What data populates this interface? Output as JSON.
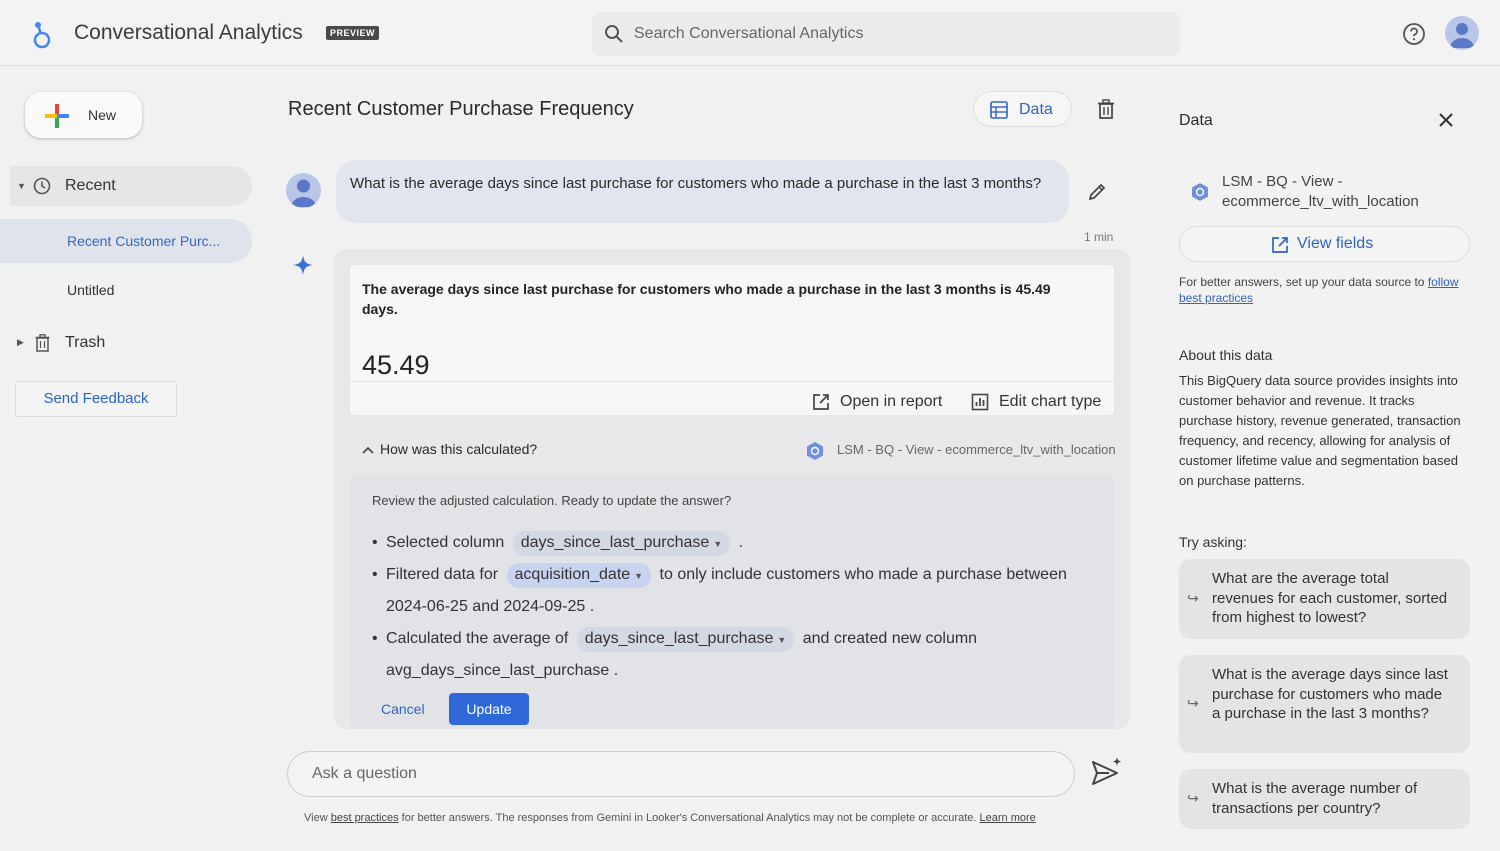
{
  "header": {
    "app_title": "Conversational Analytics",
    "badge": "PREVIEW",
    "search_placeholder": "Search Conversational Analytics",
    "icons": [
      "help-icon",
      "account-avatar"
    ]
  },
  "sidebar": {
    "new_label": "New",
    "recent_label": "Recent",
    "recent_items": [
      "Recent Customer Purc...",
      "Untitled"
    ],
    "trash_label": "Trash",
    "feedback_label": "Send Feedback"
  },
  "conversation": {
    "title": "Recent Customer Purchase Frequency",
    "data_button_label": "Data",
    "user_message": "What is the average days since last purchase for customers who made a purchase in the last 3 months?",
    "message_time": "1 min",
    "answer_text": "The average days since last purchase for customers who made a purchase in the last 3 months is 45.49 days.",
    "answer_value": "45.49",
    "open_report_label": "Open in report",
    "edit_chart_label": "Edit chart type",
    "how_calculated_label": "How was this calculated?",
    "source_label": "LSM - BQ - View - ecommerce_ltv_with_location",
    "review_text": "Review the adjusted calculation. Ready to update the answer?",
    "step1_prefix": "Selected column",
    "step1_chip": "days_since_last_purchase",
    "step1_suffix": ".",
    "step2_prefix": "Filtered data for",
    "step2_chip": "acquisition_date",
    "step2_suffix": "to only include customers who made a purchase between",
    "step2_range": "2024-06-25 and 2024-09-25 .",
    "step3_prefix": "Calculated the average of",
    "step3_chip": "days_since_last_purchase",
    "step3_suffix": "and created new column",
    "step3_new_column": "avg_days_since_last_purchase .",
    "cancel_label": "Cancel",
    "update_label": "Update",
    "ask_placeholder": "Ask a question",
    "footer_pre": "View",
    "footer_link1": "best practices",
    "footer_mid": "for better answers. The responses from Gemini in Looker's Conversational Analytics may not be complete or accurate.",
    "footer_link2": "Learn more"
  },
  "data_panel": {
    "title": "Data",
    "source_name": "LSM - BQ - View - ecommerce_ltv_with_location",
    "view_fields_label": "View fields",
    "hint_text": "For better answers, set up your data source to",
    "hint_link": "follow best practices",
    "about_title": "About this data",
    "about_text": "This BigQuery data source provides insights into customer behavior and revenue. It tracks purchase history, revenue generated, transaction frequency, and recency, allowing for analysis of customer lifetime value and segmentation based on purchase patterns.",
    "try_asking_label": "Try asking:",
    "suggestions": [
      "What are the average total revenues for each customer, sorted from highest to lowest?",
      "What is the average days since last purchase for customers who made a purchase in the last 3 months?",
      "What is the average number of transactions per country?"
    ]
  },
  "colors": {
    "accent": "#2e63c8",
    "update_button": "#2f68d8"
  }
}
